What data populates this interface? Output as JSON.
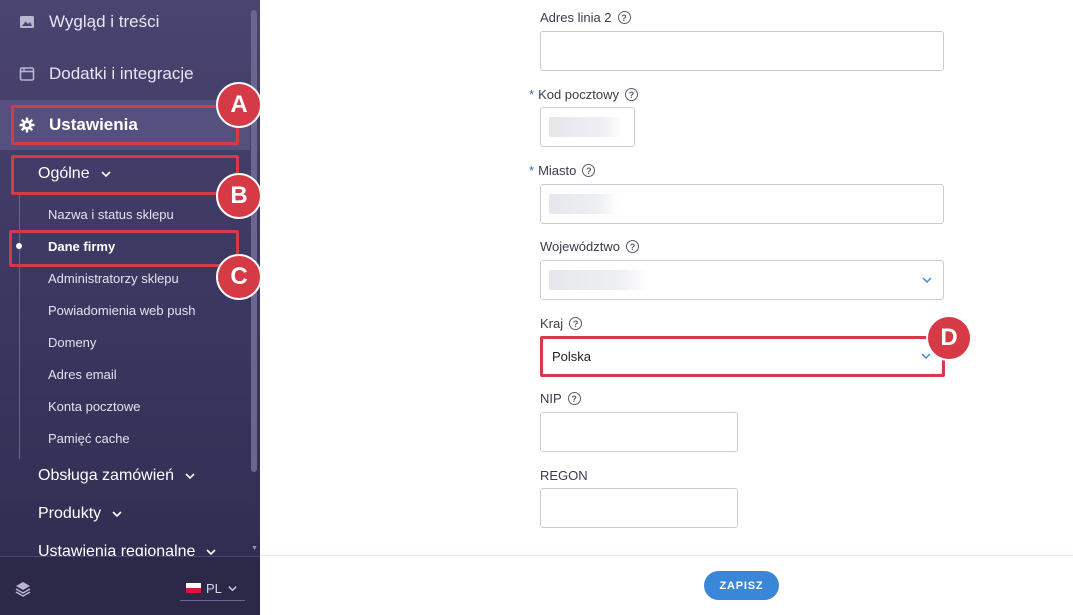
{
  "sidebar": {
    "main_items": [
      {
        "label": "Wygląd i treści",
        "icon": "image-icon"
      },
      {
        "label": "Dodatki i integracje",
        "icon": "window-icon"
      },
      {
        "label": "Ustawienia",
        "icon": "gear-icon"
      }
    ],
    "sections": [
      {
        "label": "Ogólne"
      },
      {
        "label": "Obsługa zamówień"
      },
      {
        "label": "Produkty"
      },
      {
        "label": "Ustawienia regionalne"
      }
    ],
    "submenu": [
      "Nazwa i status sklepu",
      "Dane firmy",
      "Administratorzy sklepu",
      "Powiadomienia web push",
      "Domeny",
      "Adres email",
      "Konta pocztowe",
      "Pamięć cache"
    ],
    "active_submenu": "Dane firmy",
    "language": "PL"
  },
  "annotations": {
    "a": "A",
    "b": "B",
    "c": "C",
    "d": "D",
    "color": "#d63a47"
  },
  "form": {
    "address2": {
      "label": "Adres linia 2",
      "value": ""
    },
    "postal": {
      "label": "Kod pocztowy",
      "required_mark": "*"
    },
    "city": {
      "label": "Miasto",
      "required_mark": "*"
    },
    "region": {
      "label": "Województwo"
    },
    "country": {
      "label": "Kraj",
      "value": "Polska"
    },
    "nip": {
      "label": "NIP",
      "value": ""
    },
    "regon": {
      "label": "REGON",
      "value": ""
    },
    "help_glyph": "?"
  },
  "footer": {
    "save_label": "ZAPISZ"
  },
  "colors": {
    "sidebar_bg": "#3d3862",
    "accent": "#3a86d8",
    "highlight": "#d63a47"
  }
}
